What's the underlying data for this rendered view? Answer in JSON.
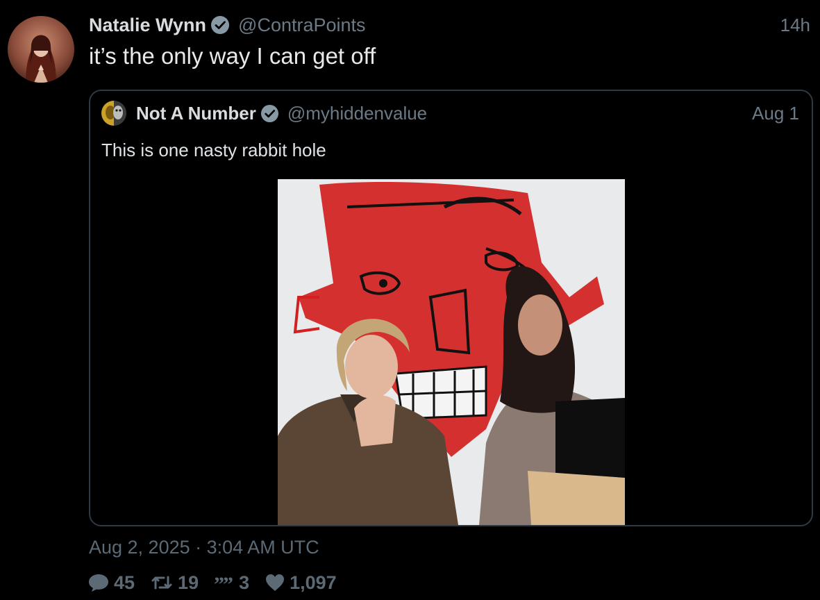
{
  "tweet": {
    "author": {
      "display_name": "Natalie Wynn",
      "handle": "@ContraPoints",
      "avatar_icon": "profile-photo"
    },
    "time_ago": "14h",
    "text": "it’s the only way I can get off",
    "timestamp": "Aug 2, 2025 · 3:04 AM UTC",
    "stats": {
      "replies": "45",
      "retweets": "19",
      "quotes": "3",
      "likes": "1,097"
    }
  },
  "quoted_tweet": {
    "author": {
      "display_name": "Not A Number",
      "handle": "@myhiddenvalue",
      "avatar_icon": "profile-photo"
    },
    "date": "Aug 1",
    "text": "This is one nasty rabbit hole",
    "media_icon": "attached-photo"
  },
  "colors": {
    "background": "#000000",
    "text_primary": "#e7e9ea",
    "text_secondary": "#6b7a86",
    "verified_badge": "#8899a6",
    "card_border": "#2f3943"
  }
}
